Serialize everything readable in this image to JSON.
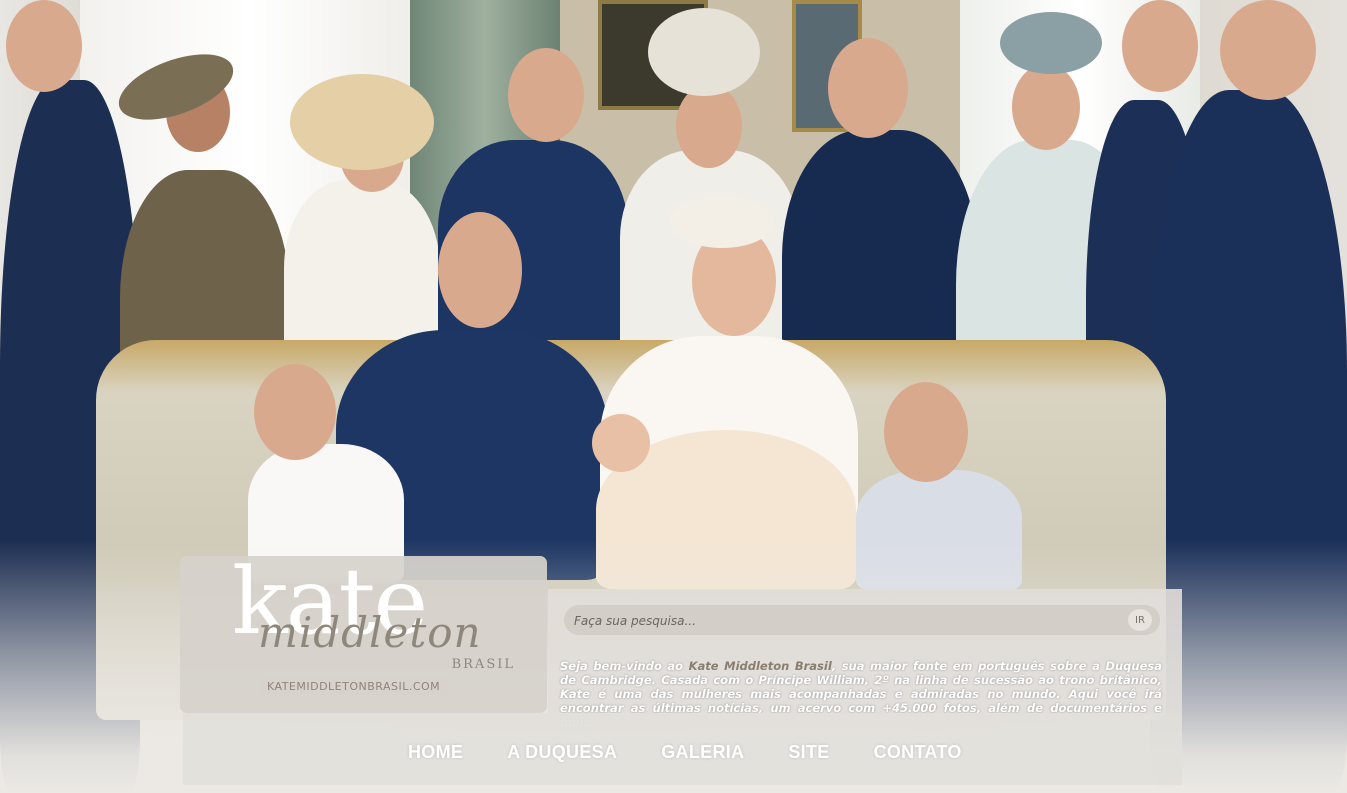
{
  "hero": {
    "image_description_icon": "family-portrait-photo"
  },
  "logo": {
    "word": "kate",
    "script": "middleton",
    "country": "BRASIL",
    "url": "KATEMIDDLETONBRASIL.COM"
  },
  "search": {
    "placeholder": "Faça sua pesquisa...",
    "button_label": "IR"
  },
  "welcome": {
    "prefix": "Seja bem-vindo ao ",
    "site_name": "Kate Middleton Brasil",
    "body": ", sua maior fonte em português sobre a Duquesa de Cambridge. Casada com o Príncipe William, 2º na linha de sucessão ao trono britânico, Kate é uma das mulheres mais acompanhadas e admiradas no mundo. Aqui você irá encontrar as últimas notícias, um acervo com +45.000 fotos, além de documentários e mais."
  },
  "nav": {
    "items": [
      {
        "label": "HOME"
      },
      {
        "label": "A DUQUESA"
      },
      {
        "label": "GALERIA"
      },
      {
        "label": "SITE"
      },
      {
        "label": "CONTATO"
      }
    ]
  },
  "colors": {
    "accent": "#8a7e70",
    "panel": "#e1ded9",
    "navy": "#1b2f55"
  }
}
